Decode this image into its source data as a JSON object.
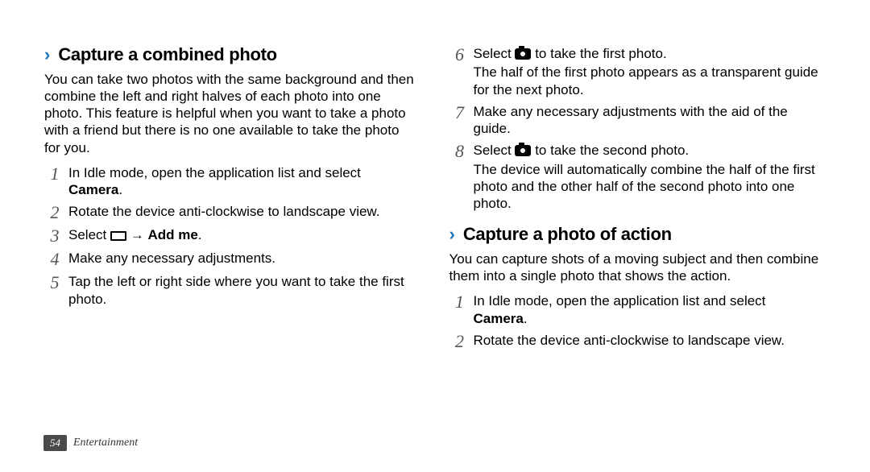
{
  "left": {
    "section1": {
      "title": "Capture a combined photo",
      "intro": "You can take two photos with the same background and then combine the left and right halves of each photo into one photo. This feature is helpful when you want to take a photo with a friend but there is no one available to take the photo for you.",
      "steps": {
        "s1_a": "In Idle mode, open the application list and select ",
        "s1_b": "Camera",
        "s1_c": ".",
        "s2": "Rotate the device anti-clockwise to landscape view.",
        "s3_a": "Select ",
        "s3_arrow": " → ",
        "s3_b": "Add me",
        "s3_c": ".",
        "s4": "Make any necessary adjustments.",
        "s5": "Tap the left or right side where you want to take the first photo."
      }
    }
  },
  "right": {
    "steps_cont": {
      "s6_a": "Select ",
      "s6_b": " to take the first photo.",
      "s6_extra": "The half of the first photo appears as a transparent guide for the next photo.",
      "s7": "Make any necessary adjustments with the aid of the guide.",
      "s8_a": "Select ",
      "s8_b": " to take the second photo.",
      "s8_extra": "The device will automatically combine the half of the first photo and the other half of the second photo into one photo."
    },
    "section2": {
      "title": "Capture a photo of action",
      "intro": "You can capture shots of a moving subject and then combine them into a single photo that shows the action.",
      "steps": {
        "s1_a": "In Idle mode, open the application list and select ",
        "s1_b": "Camera",
        "s1_c": ".",
        "s2": "Rotate the device anti-clockwise to landscape view."
      }
    }
  },
  "nums": {
    "n1": "1",
    "n2": "2",
    "n3": "3",
    "n4": "4",
    "n5": "5",
    "n6": "6",
    "n7": "7",
    "n8": "8"
  },
  "footer": {
    "page": "54",
    "label": "Entertainment"
  }
}
